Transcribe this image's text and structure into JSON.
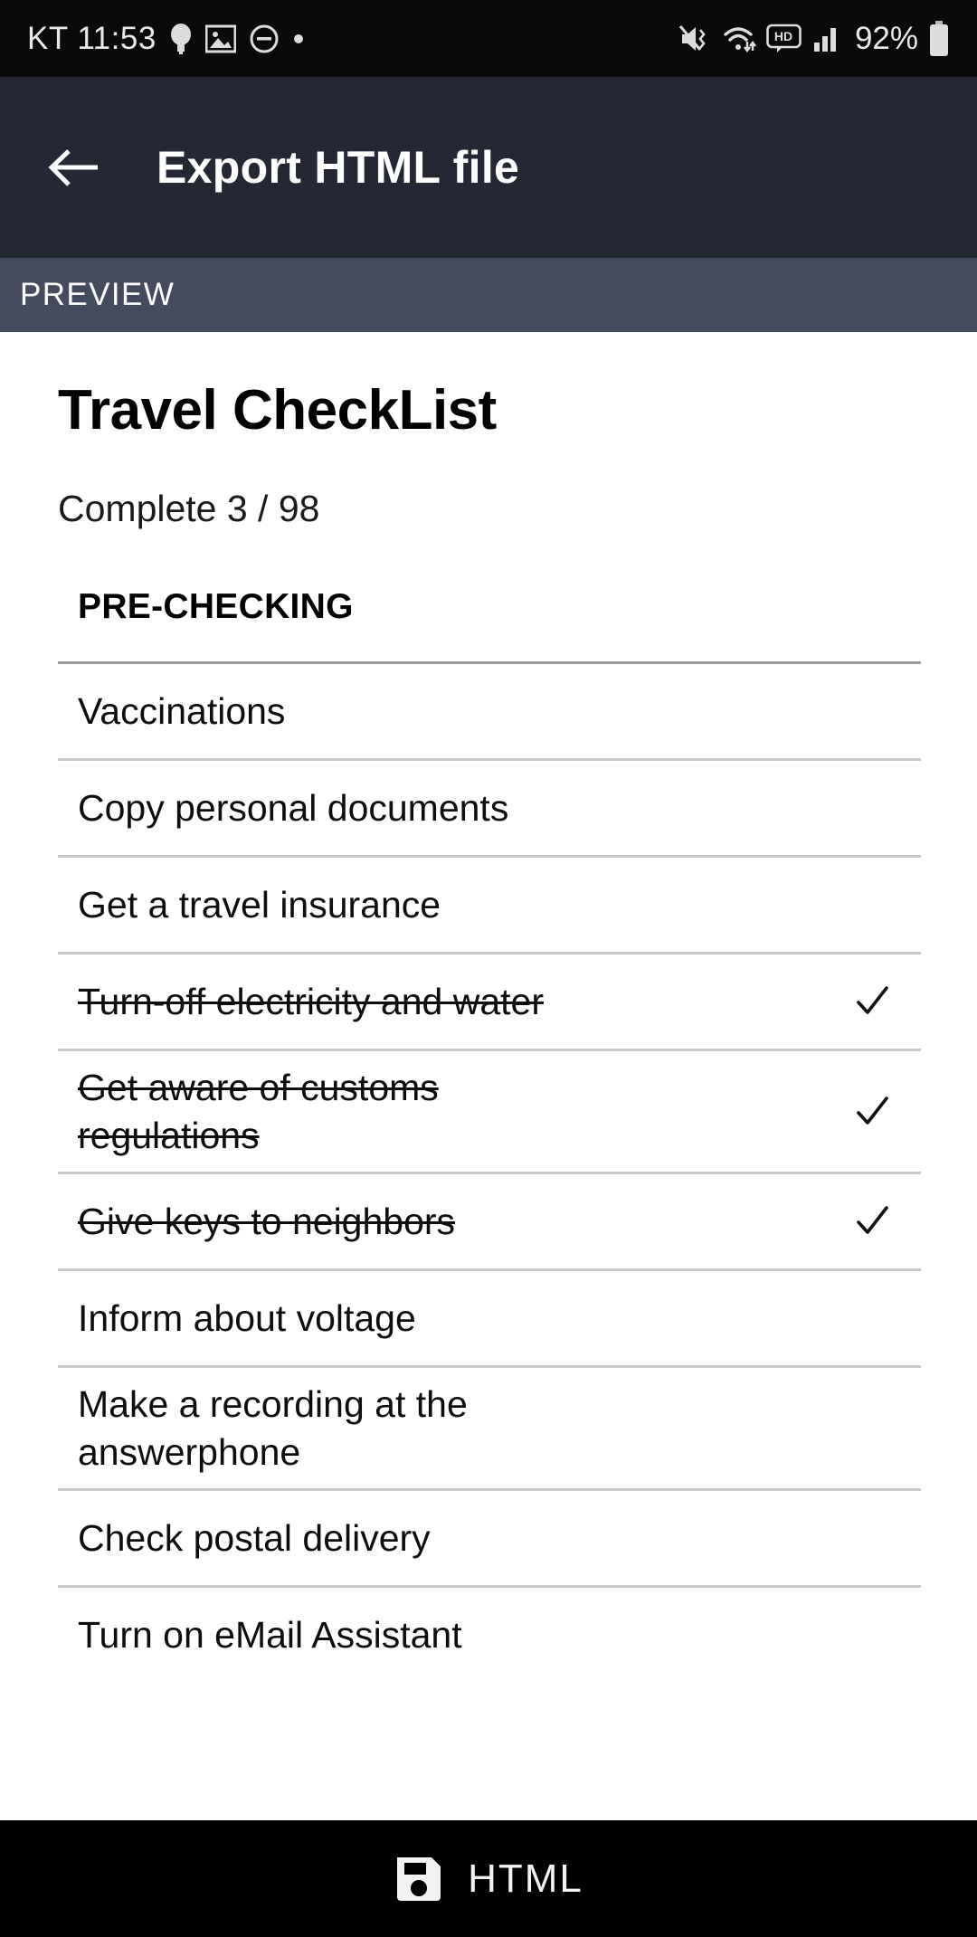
{
  "status_bar": {
    "carrier_time": "KT 11:53",
    "battery_percent": "92%",
    "left_icons": [
      "lightbulb-icon",
      "image-icon",
      "do-not-disturb-icon",
      "dot-icon"
    ],
    "right_icons": [
      "vibrate-mute-icon",
      "wifi-icon",
      "hd-icon",
      "cellular-signal-icon",
      "battery-icon"
    ],
    "background": "#0a0a0a",
    "foreground": "#e9e9e9"
  },
  "app_bar": {
    "title": "Export HTML file",
    "back_icon": "arrow-left-icon",
    "background": "#232834",
    "foreground": "#ffffff"
  },
  "preview_bar": {
    "label": "PREVIEW",
    "background": "#454b5f",
    "foreground": "#ffffff"
  },
  "document": {
    "title": "Travel CheckList",
    "complete_text": "Complete 3 / 98",
    "completed_count": "3",
    "total_count": "98",
    "section": {
      "heading": "PRE-CHECKING",
      "items": [
        {
          "label": "Vaccinations",
          "done": false,
          "check": ""
        },
        {
          "label": "Copy personal documents",
          "done": false,
          "check": ""
        },
        {
          "label": "Get a travel insurance",
          "done": false,
          "check": ""
        },
        {
          "label": "Turn-off electricity and water",
          "done": true,
          "check": "✓"
        },
        {
          "label": "Get aware of customs regulations",
          "done": true,
          "check": "✓"
        },
        {
          "label": "Give keys to neighbors",
          "done": true,
          "check": "✓"
        },
        {
          "label": "Inform about voltage",
          "done": false,
          "check": ""
        },
        {
          "label": "Make a recording at the answerphone",
          "done": false,
          "check": ""
        },
        {
          "label": "Check postal delivery",
          "done": false,
          "check": ""
        },
        {
          "label": "Turn on eMail Assistant",
          "done": false,
          "check": ""
        }
      ]
    }
  },
  "bottom_bar": {
    "label": "HTML",
    "icon": "save-floppy-icon",
    "background": "#000000",
    "foreground": "#f2f2f2"
  }
}
